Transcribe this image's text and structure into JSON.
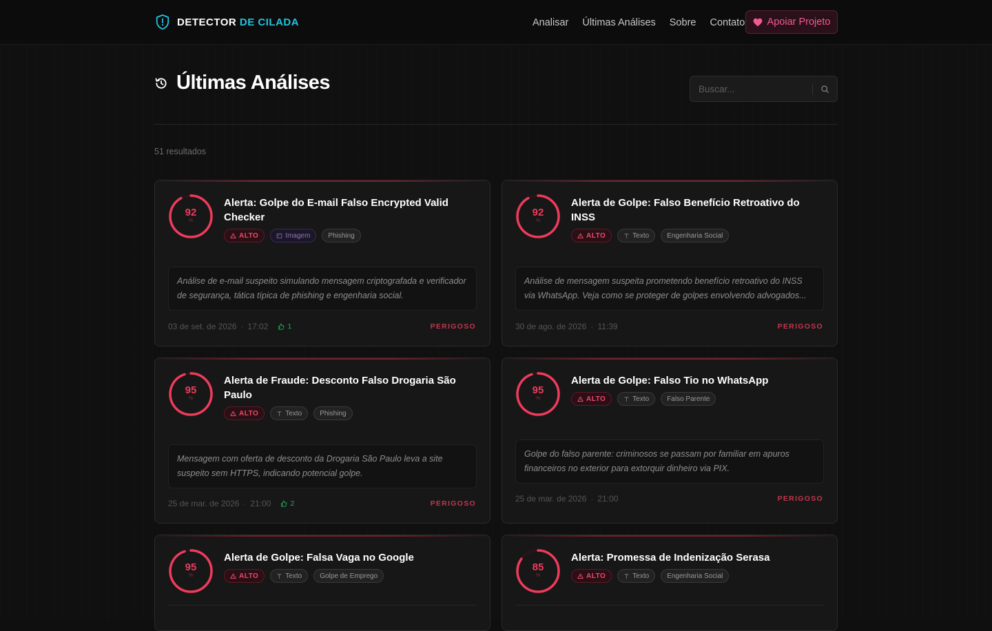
{
  "header": {
    "brand_part1": "DETECTOR",
    "brand_part2": "DE CILADA",
    "nav": [
      "Analisar",
      "Últimas Análises",
      "Sobre",
      "Contato"
    ],
    "support_label": "Apoiar Projeto",
    "icons": {
      "logo": "shield-alert-icon",
      "support": "heart-icon"
    }
  },
  "page": {
    "title": "Últimas Análises",
    "title_icon": "history-icon",
    "search_placeholder": "Buscar...",
    "results_count": "51 resultados"
  },
  "colors": {
    "accent_cyan": "#22c4e0",
    "danger_red": "#ef3b5c",
    "support_pink": "#f25a92",
    "likes_green": "#1faa5a"
  },
  "cards": [
    {
      "score": "92",
      "score_value": 92,
      "pct": "%",
      "title": "Alerta: Golpe do E-mail Falso Encrypted Valid Checker",
      "risk": "ALTO",
      "type": "Imagem",
      "category": "Phishing",
      "description": "Análise de e-mail suspeito simulando mensagem criptografada e verificador de segurança, tática típica de phishing e engenharia social.",
      "date": "03 de set. de 2026",
      "time": "17:02",
      "likes": "1",
      "status": "PERIGOSO"
    },
    {
      "score": "92",
      "score_value": 92,
      "pct": "%",
      "title": "Alerta de Golpe: Falso Benefício Retroativo do INSS",
      "risk": "ALTO",
      "type": "Texto",
      "category": "Engenharia Social",
      "description": "Análise de mensagem suspeita prometendo benefício retroativo do INSS via WhatsApp. Veja como se proteger de golpes envolvendo advogados...",
      "date": "30 de ago. de 2026",
      "time": "11:39",
      "likes": "",
      "status": "PERIGOSO"
    },
    {
      "score": "95",
      "score_value": 95,
      "pct": "%",
      "title": "Alerta de Fraude: Desconto Falso Drogaria São Paulo",
      "risk": "ALTO",
      "type": "Texto",
      "category": "Phishing",
      "description": "Mensagem com oferta de desconto da Drogaria São Paulo leva a site suspeito sem HTTPS, indicando potencial golpe.",
      "date": "25 de mar. de 2026",
      "time": "21:00",
      "likes": "2",
      "status": "PERIGOSO"
    },
    {
      "score": "95",
      "score_value": 95,
      "pct": "%",
      "title": "Alerta de Golpe: Falso Tio no WhatsApp",
      "risk": "ALTO",
      "type": "Texto",
      "category": "Falso Parente",
      "description": "Golpe do falso parente: criminosos se passam por familiar em apuros financeiros no exterior para extorquir dinheiro via PIX.",
      "date": "25 de mar. de 2026",
      "time": "21:00",
      "likes": "",
      "status": "PERIGOSO"
    },
    {
      "score": "95",
      "score_value": 95,
      "pct": "%",
      "title": "Alerta de Golpe: Falsa Vaga no Google",
      "risk": "ALTO",
      "type": "Texto",
      "category": "Golpe de Emprego"
    },
    {
      "score": "85",
      "score_value": 85,
      "pct": "%",
      "title": "Alerta: Promessa de Indenização Serasa",
      "risk": "ALTO",
      "type": "Texto",
      "category": "Engenharia Social"
    }
  ]
}
